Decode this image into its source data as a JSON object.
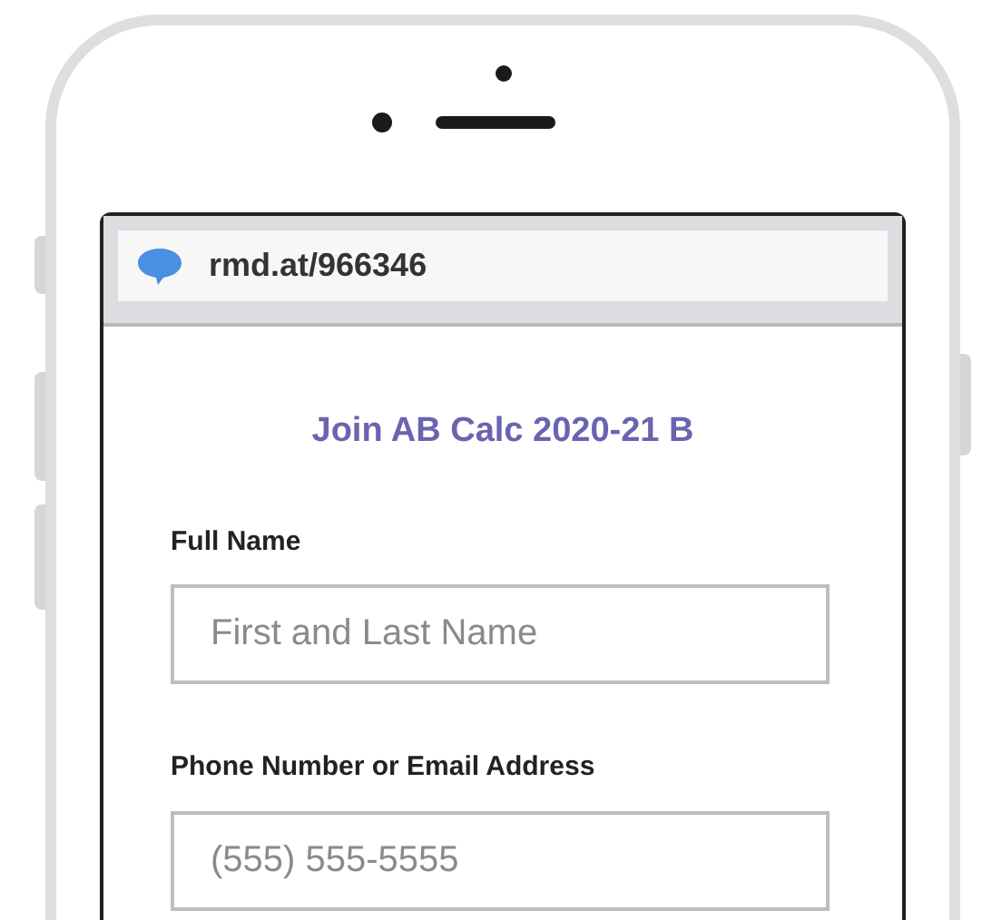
{
  "address_bar": {
    "url": "rmd.at/966346"
  },
  "form": {
    "title": "Join AB Calc 2020-21 B",
    "fields": [
      {
        "label": "Full Name",
        "placeholder": "First and Last Name"
      },
      {
        "label": "Phone Number or Email Address",
        "placeholder": "(555) 555-5555"
      }
    ]
  }
}
